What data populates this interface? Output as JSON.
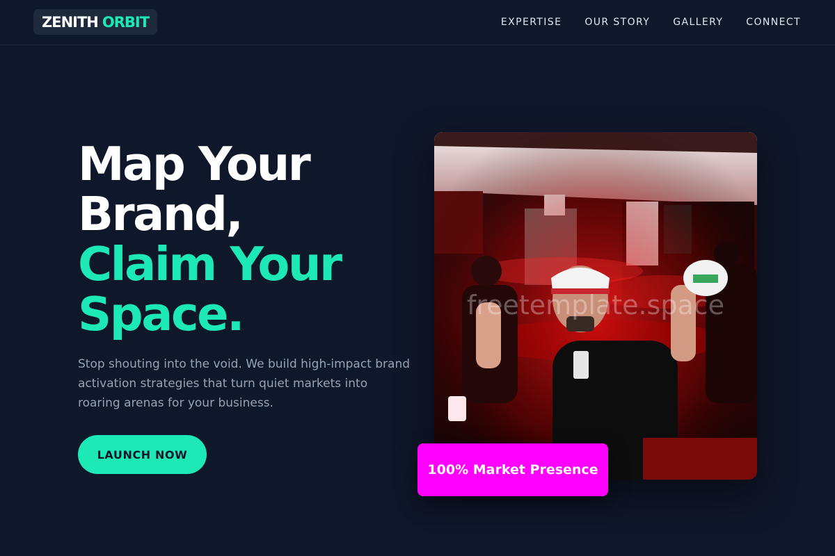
{
  "brand": {
    "logo_word1": "ZENITH",
    "logo_word2": "ORBIT",
    "accent_color": "#1de9b6",
    "background_color": "#0f172a"
  },
  "nav": {
    "items": [
      {
        "label": "EXPERTISE"
      },
      {
        "label": "OUR STORY"
      },
      {
        "label": "GALLERY"
      },
      {
        "label": "CONNECT"
      }
    ]
  },
  "hero": {
    "headline_lines": [
      "Map Your",
      "Brand,"
    ],
    "headline_accent_lines": [
      "Claim Your",
      "Space."
    ],
    "subtext": "Stop shouting into the void. We build high-impact brand activation strategies that turn quiet markets into roaring arenas for your business.",
    "cta_label": "LAUNCH NOW",
    "badge_text": "100% Market Presence",
    "badge_color": "#ff00ff",
    "image_watermark": "freetemplate.space"
  }
}
